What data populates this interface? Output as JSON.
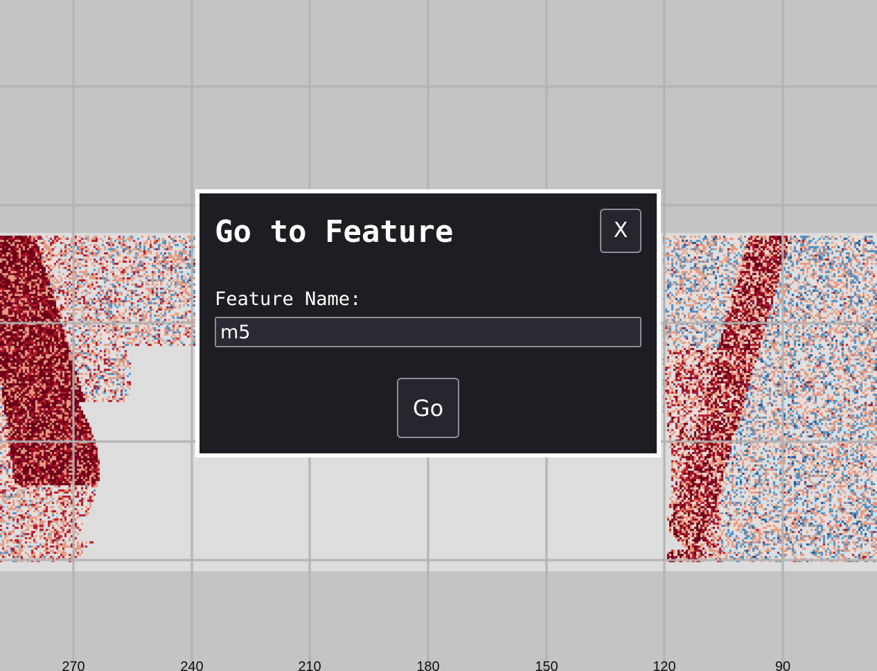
{
  "sky_map": {
    "ra_axis_ticks": [
      "270",
      "240",
      "210",
      "180",
      "150",
      "120",
      "90"
    ],
    "colors": {
      "background": "#c4c4c4",
      "footprint_gap": "#dedddd",
      "grid": "#b2b2b2",
      "deep_red": "#6c0018",
      "red": "#b2182b",
      "light_red": "#e59a82",
      "pale": "#f0ddd4",
      "pale_blue": "#cfe1ec",
      "blue": "#4f8fc0",
      "deep_blue": "#1f4e8a"
    }
  },
  "dialog": {
    "title": "Go to Feature",
    "close_label": "X",
    "field_label": "Feature Name:",
    "input_value": "m5",
    "submit_label": "Go"
  }
}
